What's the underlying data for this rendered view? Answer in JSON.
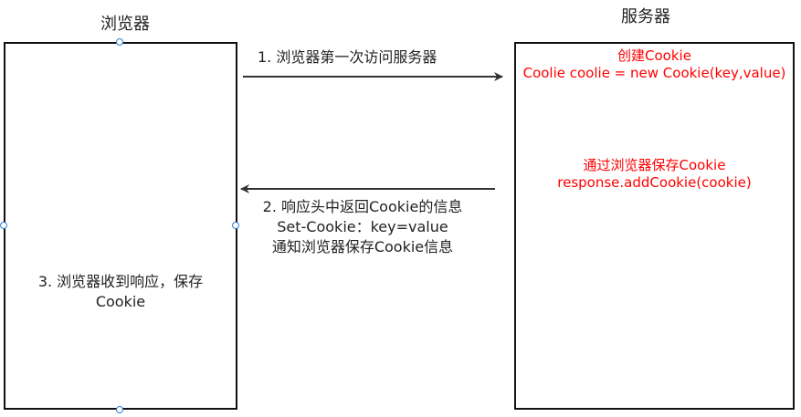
{
  "browser": {
    "title": "浏览器",
    "note_lines": [
      "3. 浏览器收到响应，保存",
      "Cookie"
    ]
  },
  "server": {
    "title": "服务器",
    "create_lines": [
      "创建Cookie",
      "Coolie coolie = new Cookie(key,value)"
    ],
    "save_lines": [
      "通过浏览器保存Cookie",
      "response.addCookie(cookie)"
    ]
  },
  "request": {
    "label": "1. 浏览器第一次访问服务器"
  },
  "response": {
    "lines": [
      "2. 响应头中返回Cookie的信息",
      "Set-Cookie：key=value",
      "通知浏览器保存Cookie信息"
    ]
  },
  "colors": {
    "highlight": "#ff0000",
    "stroke": "#111111",
    "handle": "#2f7fd7"
  }
}
